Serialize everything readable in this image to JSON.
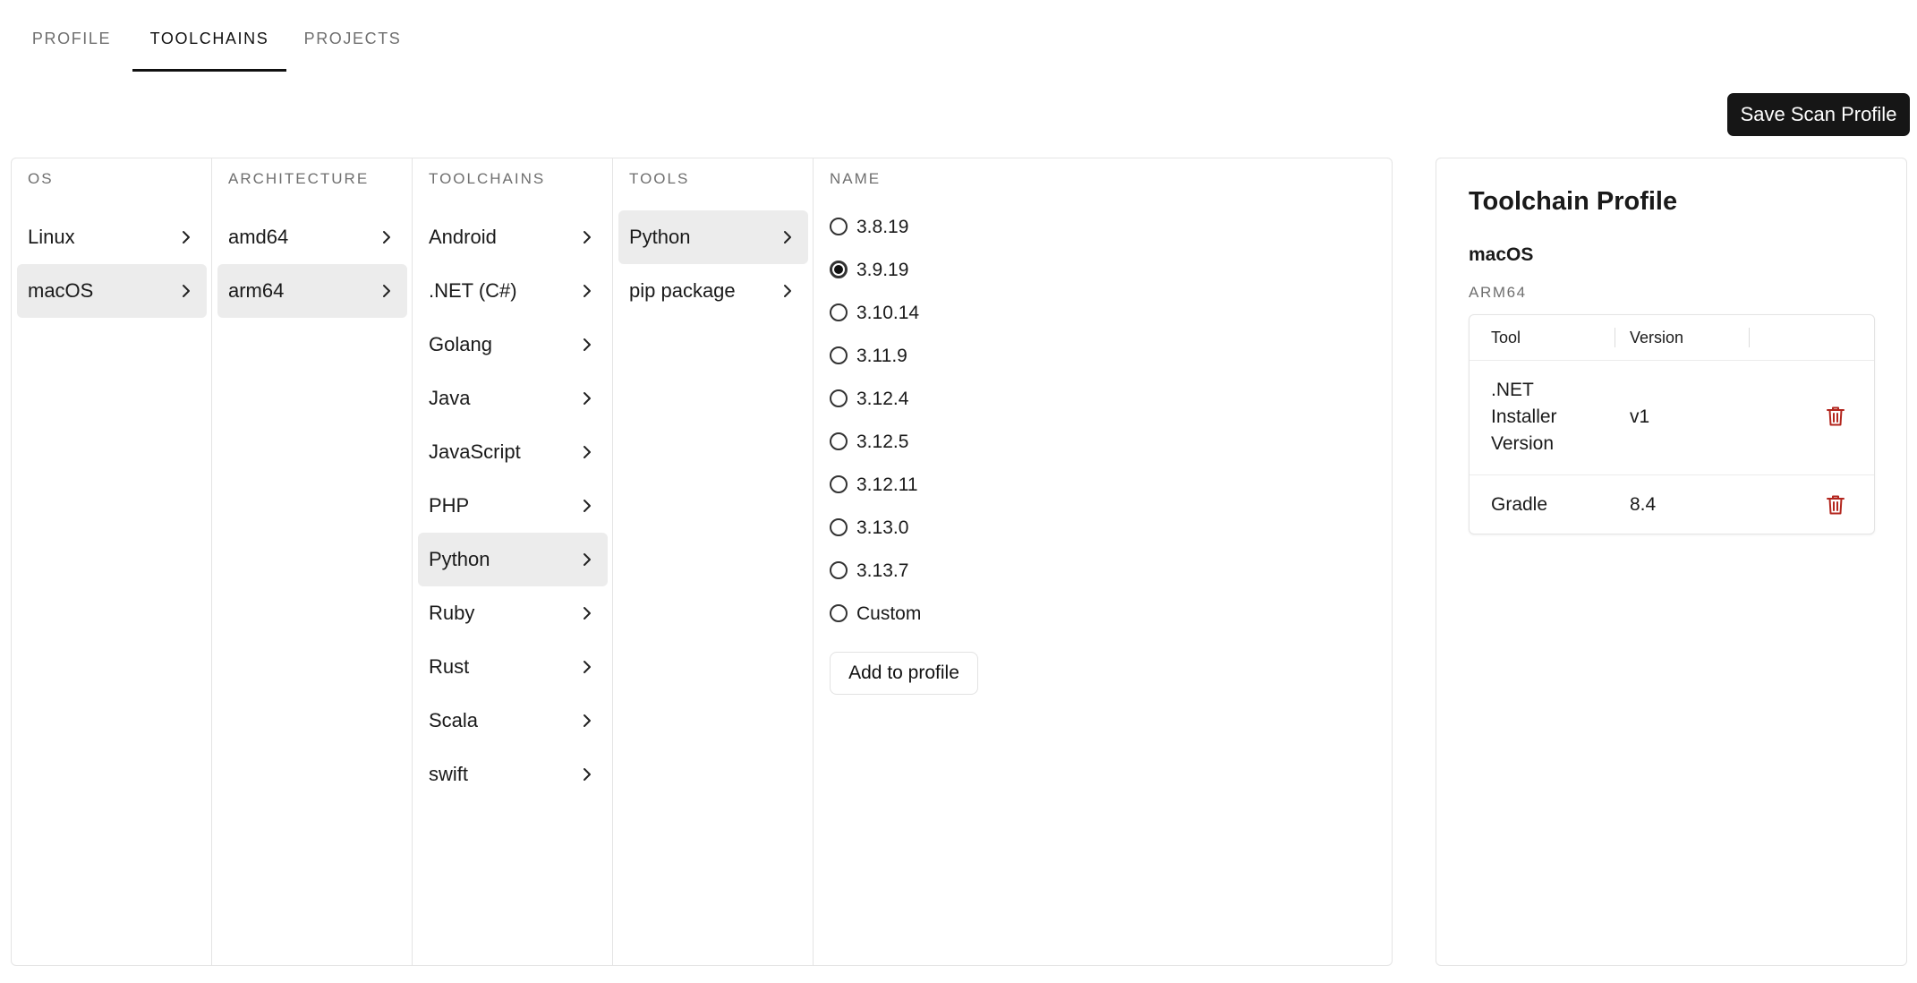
{
  "tabs": [
    {
      "label": "PROFILE"
    },
    {
      "label": "TOOLCHAINS"
    },
    {
      "label": "PROJECTS"
    }
  ],
  "active_tab": "TOOLCHAINS",
  "save_button": {
    "label": "Save Scan Profile"
  },
  "columns": {
    "os": {
      "header": "OS",
      "items": [
        "Linux",
        "macOS"
      ],
      "selected": "macOS"
    },
    "architecture": {
      "header": "ARCHITECTURE",
      "items": [
        "amd64",
        "arm64"
      ],
      "selected": "arm64"
    },
    "toolchains": {
      "header": "TOOLCHAINS",
      "items": [
        ".NET (C#)",
        "Android",
        "Golang",
        "Java",
        "JavaScript",
        "PHP",
        "Python",
        "Ruby",
        "Rust",
        "Scala",
        "swift"
      ],
      "selected": "Python"
    },
    "tools": {
      "header": "TOOLS",
      "items": [
        "Python",
        "pip package"
      ],
      "selected": "Python"
    },
    "name": {
      "header": "NAME",
      "options": [
        "3.8.19",
        "3.9.19",
        "3.10.14",
        "3.11.9",
        "3.12.4",
        "3.12.5",
        "3.12.11",
        "3.13.0",
        "3.13.7",
        "Custom"
      ],
      "selected": "3.9.19",
      "add_button": "Add to profile"
    }
  },
  "profile": {
    "title": "Toolchain Profile",
    "os": "macOS",
    "arch": "ARM64",
    "table": {
      "headers": {
        "tool": "Tool",
        "version": "Version"
      },
      "rows": [
        {
          "tool": ".NET Installer Version",
          "tool_lines": [
            ".NET",
            "Installer",
            "Version"
          ],
          "version": "v1"
        },
        {
          "tool": "Gradle",
          "tool_lines": [
            "Gradle"
          ],
          "version": "8.4"
        }
      ]
    }
  },
  "colors": {
    "accent": "#161616",
    "selected_bg": "#ececec",
    "delete_icon": "#b3261e",
    "border": "#e4e4e4"
  },
  "icons": {
    "chevron": "chevron-right-icon",
    "delete": "trash-icon",
    "radio": "radio-icon"
  }
}
